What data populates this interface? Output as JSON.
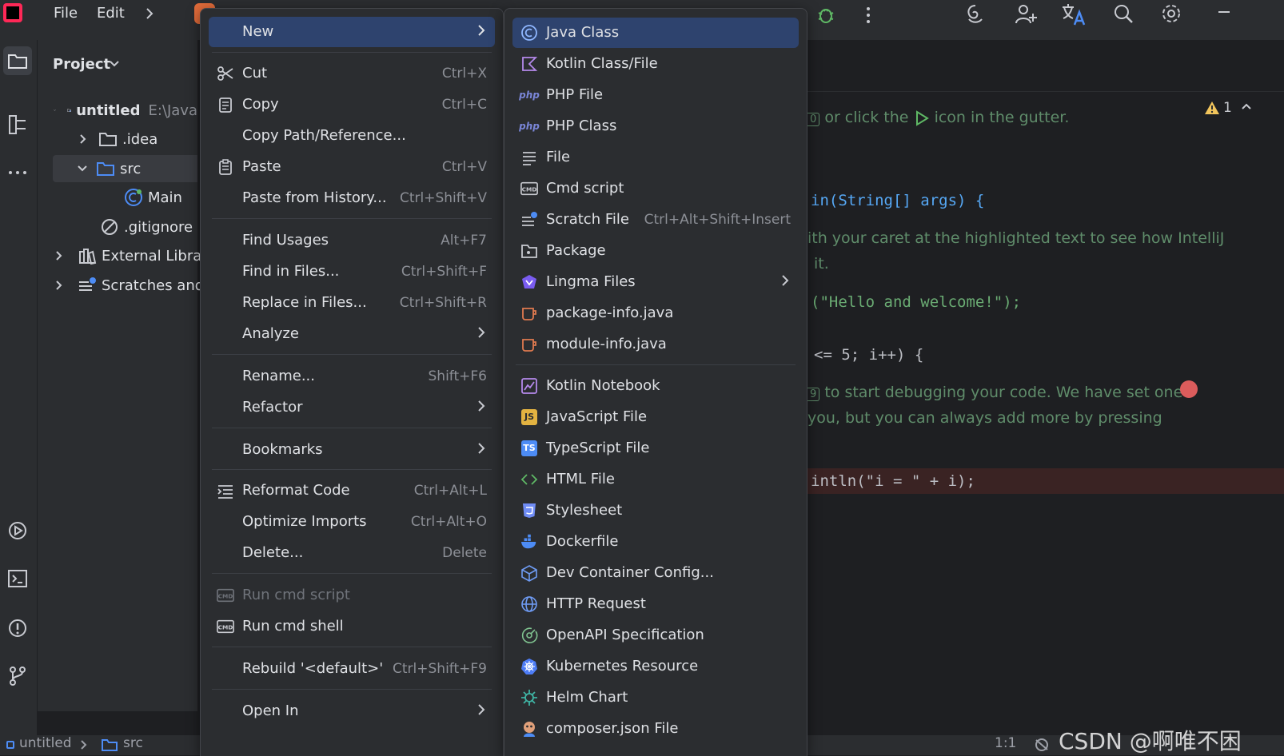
{
  "titlebar": {
    "menu_file": "File",
    "menu_edit": "Edit",
    "icons": [
      "ai-assistant-icon",
      "add-user-icon",
      "translate-icon",
      "search-icon",
      "settings-icon",
      "minimize-icon"
    ]
  },
  "project_panel": {
    "title": "Project",
    "tree": [
      {
        "label": "untitled",
        "hint": "E:\\Java"
      },
      {
        "label": ".idea"
      },
      {
        "label": "src"
      },
      {
        "label": "Main"
      },
      {
        "label": ".gitignore"
      },
      {
        "label": "External Librarie"
      },
      {
        "label": "Scratches and C"
      }
    ]
  },
  "editor": {
    "warning_count": "1",
    "lines": {
      "hint_run_pre": "or click the",
      "hint_run_post": "icon in the gutter.",
      "main_sig": "in(String[] args) {",
      "doc1": "ith your caret at the highlighted text to see how IntelliJ",
      "doc2": "it.",
      "hello": "(\"Hello and welcome!\");",
      "loop": "<= 5; i++) {",
      "debug1": "to start debugging your code. We have set one",
      "debug2": "you, but you can always add more by pressing",
      "println": "intln(\"i = \" + i);"
    }
  },
  "context_menu": {
    "items": [
      {
        "label": "New",
        "shortcut": "",
        "submenu": true,
        "selected": true
      },
      {
        "label": "Cut",
        "shortcut": "Ctrl+X",
        "icon": "scissors-icon"
      },
      {
        "label": "Copy",
        "shortcut": "Ctrl+C",
        "icon": "copy-icon"
      },
      {
        "label": "Copy Path/Reference...",
        "shortcut": ""
      },
      {
        "label": "Paste",
        "shortcut": "Ctrl+V",
        "icon": "paste-icon"
      },
      {
        "label": "Paste from History...",
        "shortcut": "Ctrl+Shift+V"
      },
      {
        "label": "Find Usages",
        "shortcut": "Alt+F7"
      },
      {
        "label": "Find in Files...",
        "shortcut": "Ctrl+Shift+F"
      },
      {
        "label": "Replace in Files...",
        "shortcut": "Ctrl+Shift+R"
      },
      {
        "label": "Analyze",
        "shortcut": "",
        "submenu": true
      },
      {
        "label": "Rename...",
        "shortcut": "Shift+F6"
      },
      {
        "label": "Refactor",
        "shortcut": "",
        "submenu": true
      },
      {
        "label": "Bookmarks",
        "shortcut": "",
        "submenu": true
      },
      {
        "label": "Reformat Code",
        "shortcut": "Ctrl+Alt+L",
        "icon": "reformat-icon"
      },
      {
        "label": "Optimize Imports",
        "shortcut": "Ctrl+Alt+O"
      },
      {
        "label": "Delete...",
        "shortcut": "Delete"
      },
      {
        "label": "Run cmd script",
        "shortcut": "",
        "disabled": true,
        "icon": "cmd-icon"
      },
      {
        "label": "Run cmd shell",
        "shortcut": "",
        "icon": "cmd-icon"
      },
      {
        "label": "Rebuild '<default>'",
        "shortcut": "Ctrl+Shift+F9"
      },
      {
        "label": "Open In",
        "shortcut": "",
        "submenu": true
      }
    ]
  },
  "new_submenu": {
    "items": [
      {
        "label": "Java Class",
        "icon": "java-class-icon",
        "selected": true
      },
      {
        "label": "Kotlin Class/File",
        "icon": "kotlin-icon"
      },
      {
        "label": "PHP File",
        "icon": "php-icon",
        "badge": "php"
      },
      {
        "label": "PHP Class",
        "icon": "php-icon",
        "badge": "php"
      },
      {
        "label": "File",
        "icon": "file-icon"
      },
      {
        "label": "Cmd script",
        "icon": "cmd-icon"
      },
      {
        "label": "Scratch File",
        "icon": "scratch-icon",
        "shortcut": "Ctrl+Alt+Shift+Insert"
      },
      {
        "label": "Package",
        "icon": "package-icon"
      },
      {
        "label": "Lingma Files",
        "icon": "lingma-icon",
        "submenu": true
      },
      {
        "label": "package-info.java",
        "icon": "java-cup-icon"
      },
      {
        "label": "module-info.java",
        "icon": "java-cup-icon"
      },
      {
        "label": "Kotlin Notebook",
        "icon": "notebook-icon"
      },
      {
        "label": "JavaScript File",
        "icon": "javascript-icon",
        "badge": "JS"
      },
      {
        "label": "TypeScript File",
        "icon": "typescript-icon",
        "badge": "TS"
      },
      {
        "label": "HTML File",
        "icon": "html-icon"
      },
      {
        "label": "Stylesheet",
        "icon": "css-icon"
      },
      {
        "label": "Dockerfile",
        "icon": "docker-icon"
      },
      {
        "label": "Dev Container Config...",
        "icon": "container-icon"
      },
      {
        "label": "HTTP Request",
        "icon": "globe-icon"
      },
      {
        "label": "OpenAPI Specification",
        "icon": "openapi-icon"
      },
      {
        "label": "Kubernetes Resource",
        "icon": "kubernetes-icon"
      },
      {
        "label": "Helm Chart",
        "icon": "helm-icon"
      },
      {
        "label": "composer.json File",
        "icon": "composer-icon"
      }
    ]
  },
  "statusbar": {
    "crumb1": "untitled",
    "crumb2": "src",
    "position": "1:1",
    "watermark": "CSDN @啊唯不困"
  },
  "colors": {
    "accent": "#2e436e",
    "menu_bg": "#2b2d30",
    "editor_bg": "#1e1f22",
    "keyword": "#56a8f5",
    "string": "#6aab73",
    "comment": "#5f8c6a",
    "breakpoint": "#db5c5c"
  }
}
